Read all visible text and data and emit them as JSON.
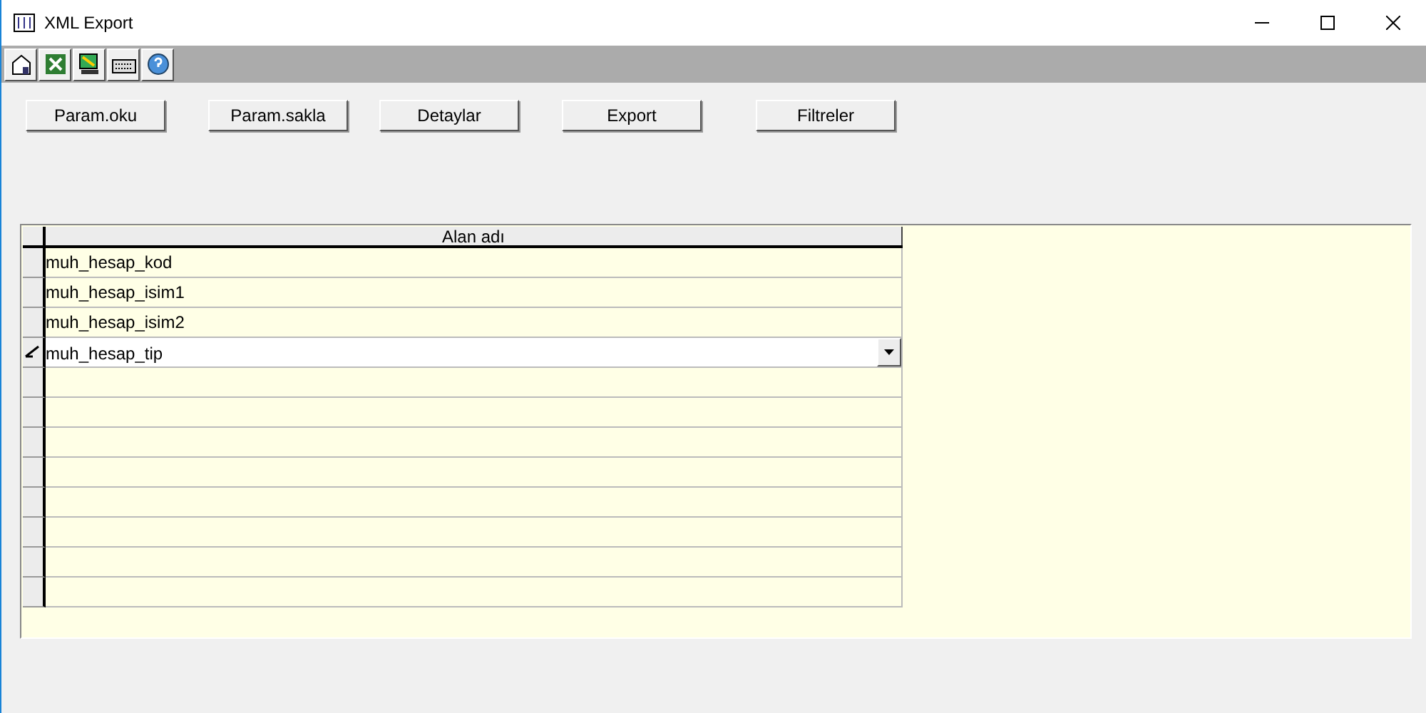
{
  "window": {
    "title": "XML Export"
  },
  "toolbar": [
    {
      "kind": "home"
    },
    {
      "kind": "excel"
    },
    {
      "kind": "export"
    },
    {
      "kind": "keyboard"
    },
    {
      "kind": "help"
    }
  ],
  "buttons": [
    "Param.oku",
    "Param.sakla",
    "Detaylar",
    "Export",
    "Filtreler"
  ],
  "grid": {
    "columns": [
      "Alan adı"
    ],
    "rows": [
      {
        "value": "muh_hesap_kod",
        "editing": false
      },
      {
        "value": "muh_hesap_isim1",
        "editing": false
      },
      {
        "value": "muh_hesap_isim2",
        "editing": false
      },
      {
        "value": "muh_hesap_tip",
        "editing": true
      },
      {
        "value": null,
        "editing": false
      },
      {
        "value": null,
        "editing": false
      },
      {
        "value": null,
        "editing": false
      },
      {
        "value": null,
        "editing": false
      },
      {
        "value": null,
        "editing": false
      },
      {
        "value": null,
        "editing": false
      },
      {
        "value": null,
        "editing": false
      },
      {
        "value": null,
        "editing": false
      }
    ]
  }
}
